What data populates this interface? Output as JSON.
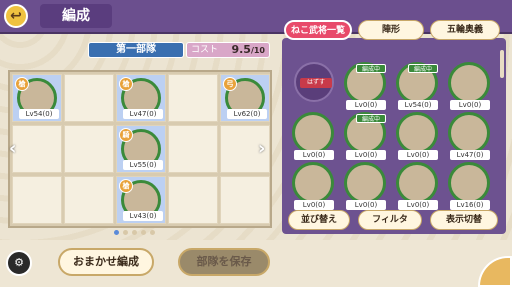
{
  "header": {
    "title": "編成",
    "back_icon": "back-arrow-icon"
  },
  "formation": {
    "unit_name": "第一部隊",
    "cost_label": "コスト",
    "cost_value": "9.5",
    "cost_max": "/10",
    "page_count": 5,
    "active_page": 1
  },
  "grid_units": [
    {
      "row": 0,
      "col": 0,
      "level": "Lv54(0)",
      "class": "槍"
    },
    {
      "row": 0,
      "col": 2,
      "level": "Lv47(0)",
      "class": "槍"
    },
    {
      "row": 0,
      "col": 4,
      "level": "Lv62(0)",
      "class": "弓"
    },
    {
      "row": 1,
      "col": 2,
      "level": "Lv55(0)",
      "class": "騎"
    },
    {
      "row": 2,
      "col": 2,
      "level": "Lv43(0)",
      "class": "槍"
    }
  ],
  "tabs": [
    {
      "label": "ねこ武将一覧",
      "active": true
    },
    {
      "label": "陣形",
      "active": false
    },
    {
      "label": "五輪奥義",
      "active": false
    }
  ],
  "roster": [
    {
      "type": "placeholder",
      "tag": "はずす"
    },
    {
      "level": "Lv0(0)",
      "ribbon": "編成中"
    },
    {
      "level": "Lv54(0)",
      "ribbon": "編成中"
    },
    {
      "level": "Lv0(0)",
      "ribbon": ""
    },
    {
      "level": "Lv0(0)",
      "ribbon": ""
    },
    {
      "level": "Lv0(0)",
      "ribbon": "編成中"
    },
    {
      "level": "Lv0(0)",
      "ribbon": ""
    },
    {
      "level": "Lv47(0)",
      "ribbon": ""
    },
    {
      "level": "Lv0(0)",
      "ribbon": ""
    },
    {
      "level": "Lv0(0)",
      "ribbon": ""
    },
    {
      "level": "Lv0(0)",
      "ribbon": ""
    },
    {
      "level": "Lv16(0)",
      "ribbon": ""
    }
  ],
  "roster_buttons": [
    "並び替え",
    "フィルタ",
    "表示切替"
  ],
  "bottom": {
    "auto_button": "おまかせ編成",
    "save_button": "部隊を保存"
  },
  "colors": {
    "header": "#6b4f8e",
    "panel": "#6d5290",
    "active_tab": "#e84a6a",
    "frame": "#3a8a3a"
  }
}
